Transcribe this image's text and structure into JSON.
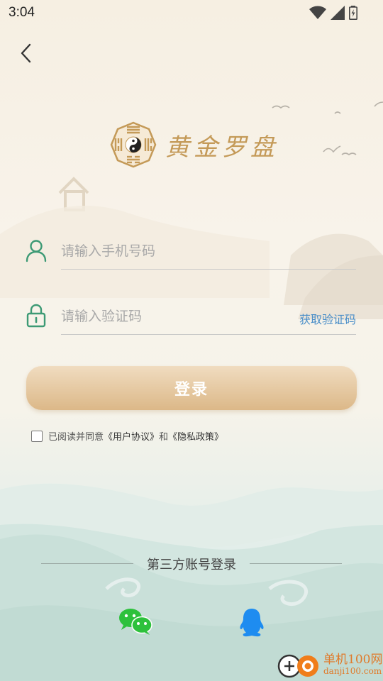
{
  "status_bar": {
    "time": "3:04"
  },
  "app": {
    "name": "黄金罗盘"
  },
  "login_form": {
    "phone_placeholder": "请输入手机号码",
    "code_placeholder": "请输入验证码",
    "get_code_label": "获取验证码",
    "submit_label": "登录"
  },
  "agreement": {
    "prefix": "已阅读并同意",
    "user_agreement": "《用户协议》",
    "conjunction": "和",
    "privacy_policy": "《隐私政策》"
  },
  "third_party": {
    "heading": "第三方账号登录",
    "providers": [
      "wechat-icon",
      "qq-icon"
    ]
  },
  "watermark": {
    "title": "单机100网",
    "url": "danji100.com"
  },
  "colors": {
    "accent_gold": "#dcb888",
    "icon_green": "#3d9a75",
    "link_blue": "#4a8ec8",
    "wechat_green": "#2dc13c",
    "qq_blue": "#1e8cf0"
  }
}
